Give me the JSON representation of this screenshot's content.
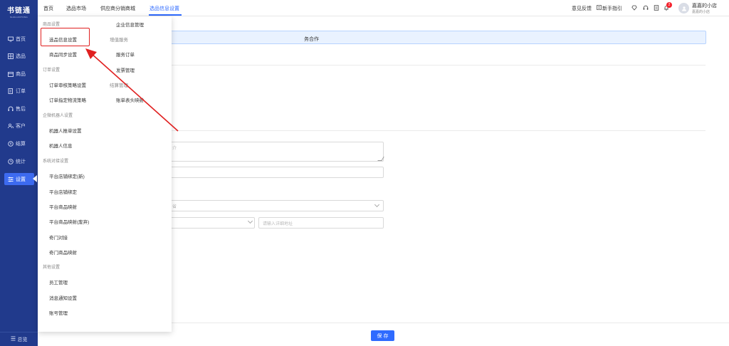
{
  "sidebar": {
    "logo": "书链通",
    "logo_sub": "SHULIANTONG",
    "items": [
      {
        "label": "首页",
        "icon": "monitor-icon"
      },
      {
        "label": "选品",
        "icon": "grid-icon"
      },
      {
        "label": "商品",
        "icon": "box-icon"
      },
      {
        "label": "订单",
        "icon": "order-icon"
      },
      {
        "label": "售后",
        "icon": "headset-icon"
      },
      {
        "label": "客户",
        "icon": "users-icon"
      },
      {
        "label": "结算",
        "icon": "settle-icon"
      },
      {
        "label": "统计",
        "icon": "clock-icon"
      },
      {
        "label": "设置",
        "icon": "settings-icon"
      }
    ],
    "overview": "总览"
  },
  "topnav": {
    "tabs": [
      "首页",
      "选品市场",
      "供应商分销商城",
      "选品信息设置"
    ],
    "active_tab": "选品信息设置"
  },
  "header_right": {
    "feedback": "意见反馈",
    "guide": "新手指引",
    "badge_count": "2",
    "user_name": "嘉嘉的小店",
    "user_sub": "嘉嘉的小店"
  },
  "dropdown": {
    "groups": {
      "goods": "商品设置",
      "order": "订单设置",
      "wecom": "企微机器人设置",
      "system": "系统对接设置",
      "other": "其他设置"
    },
    "items": {
      "select_info": "选品信息设置",
      "sync": "商品同步设置",
      "audit": "订单审核策略设置",
      "express": "订单指定物流策略",
      "robot_push": "机器人推单设置",
      "robot_info": "机器人信息",
      "platform_bind_new": "平台店铺绑定(新)",
      "platform_bind": "平台店铺绑定",
      "goods_map": "平台商品映射",
      "goods_map_old": "平台商品映射(废弃)",
      "qimen": "奇门对接",
      "qimen_map": "奇门商品映射",
      "staff": "员工管理",
      "notice": "消息通知设置",
      "account": "账号管理",
      "enterprise": "企业信息管理",
      "value_added": "增值服务",
      "service_order": "服务订单",
      "invoice": "发票管理",
      "settle_manage": "结算管理",
      "bill_title": "账单表头映射"
    }
  },
  "main": {
    "banner_text": "务合作",
    "textarea_placeholder": "介",
    "select_placeholder": "省",
    "address_placeholder": "请输入详细地址",
    "save": "保 存"
  },
  "colors": {
    "sidebar_bg": "#213a8c",
    "accent": "#2f6bff",
    "annotation": "#e02020"
  }
}
